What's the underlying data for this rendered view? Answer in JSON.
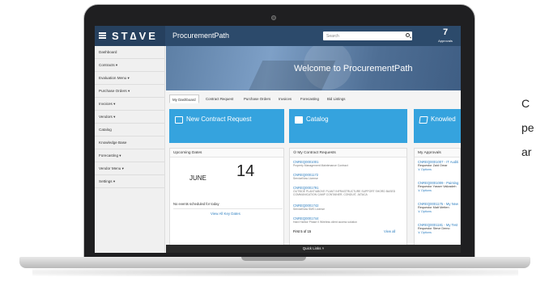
{
  "app": {
    "logo": "ST∆VE",
    "title": "ProcurementPath",
    "search_placeholder": "Search",
    "approvals_count": "7",
    "approvals_label": "Approvals"
  },
  "sidebar": {
    "items": [
      {
        "label": "Dashboard"
      },
      {
        "label": "Contracts ▾"
      },
      {
        "label": "Evaluation Menu ▾"
      },
      {
        "label": "Purchase Orders ▾"
      },
      {
        "label": "Invoices ▾"
      },
      {
        "label": "Vendors ▾"
      },
      {
        "label": "Catalog"
      },
      {
        "label": "Knowledge Base"
      },
      {
        "label": "Forecasting ▾"
      },
      {
        "label": "Vendor Menu ▾"
      },
      {
        "label": "Settings ▾"
      }
    ]
  },
  "hero": {
    "text": "Welcome to ProcurementPath"
  },
  "tabs": [
    {
      "label": "My Dashboard"
    },
    {
      "label": "Contract Request"
    },
    {
      "label": "Purchase Orders"
    },
    {
      "label": "Invoices"
    },
    {
      "label": "Forecasting"
    },
    {
      "label": "Bid Listings"
    }
  ],
  "tiles": [
    {
      "label": "New Contract Request",
      "icon": "edit-icon"
    },
    {
      "label": "Catalog",
      "icon": "folder-icon"
    },
    {
      "label": "Knowled",
      "icon": "book-icon"
    }
  ],
  "upcoming": {
    "title": "Upcoming Dates",
    "month": "JUNE",
    "day": "14",
    "no_events": "No events scheduled for today",
    "view_all": "View All Key Dates"
  },
  "contract_requests": {
    "title": "My Contract Requests",
    "items": [
      {
        "id": "CNREQ0001001",
        "desc": "Property Management Maintenance Contract"
      },
      {
        "id": "CNREQ0001172",
        "desc": "ServiceNow License"
      },
      {
        "id": "CNREQ0001791",
        "desc": "OUTSIDE PLANT/ABOVE PLANT INFRASTRUCTURE SUPPORT SHORD BASED COMMUNICATION CAMP CONTAINER, CONDUIT, JATACA"
      },
      {
        "id": "CNREQ0001742",
        "desc": "ServiceNow SMS License"
      },
      {
        "id": "CNREQ0001744",
        "desc": "Hard Harbor Phase II Wireless client access solution"
      }
    ],
    "footer_left": "First 5 of 15",
    "footer_right": "View all"
  },
  "approvals": {
    "title": "My Approvals",
    "items": [
      {
        "id": "CNREQ0001007 - IT Auditi",
        "person": "Requestor Zaid Omar",
        "opt": "∨ Options"
      },
      {
        "id": "CNREQ0001009 - Painting",
        "person": "Requestor Yasser Valizadeh",
        "opt": "∨ Options"
      },
      {
        "id": "CNREQ0001175 - My New",
        "person": "Requestor Matt Metten",
        "opt": "∨ Options"
      },
      {
        "id": "CNREQ0001181 - My Test",
        "person": "Requestor Steve Demo",
        "opt": "∨ Options"
      }
    ]
  },
  "quicklinks": {
    "label": "Quick Links ˄"
  },
  "side_text": {
    "line1": "C",
    "line2": "pe",
    "line3": "ar"
  }
}
